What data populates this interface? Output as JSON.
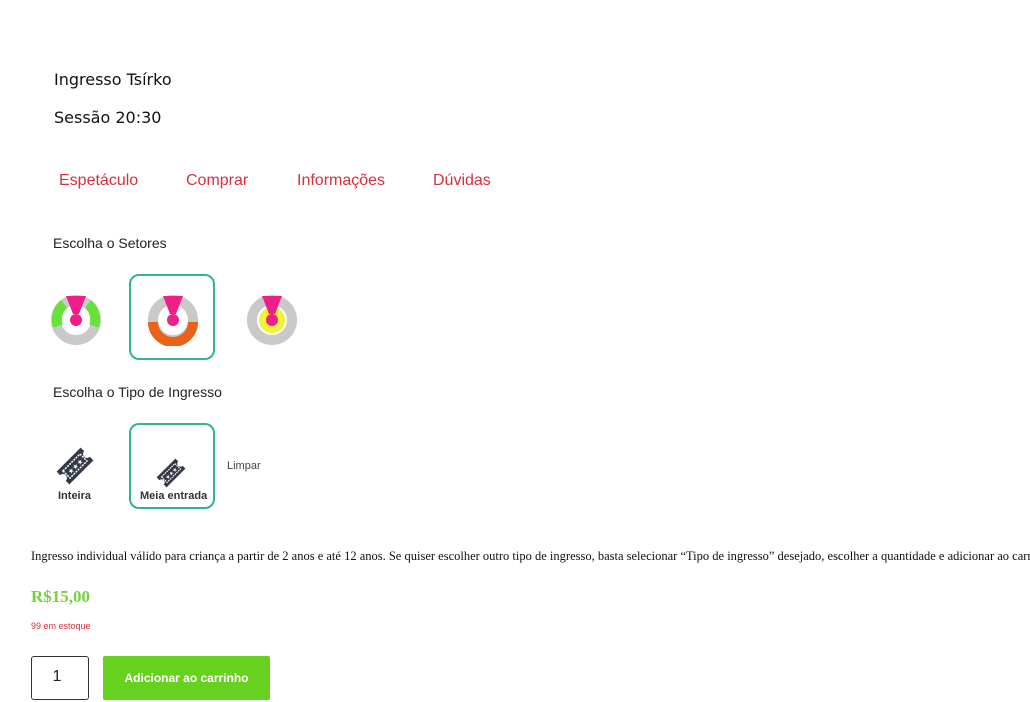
{
  "product": {
    "title": "Ingresso Tsírko",
    "session": "Sessão 20:30"
  },
  "tabs": [
    {
      "label": "Espetáculo"
    },
    {
      "label": "Comprar"
    },
    {
      "label": "Informações"
    },
    {
      "label": "Dúvidas"
    }
  ],
  "sectors": {
    "heading": "Escolha o Setores",
    "options": [
      {
        "icon": "stage-sector-green-icon",
        "accent": "#66e23a",
        "selected": false
      },
      {
        "icon": "stage-sector-orange-icon",
        "accent": "#e8621a",
        "selected": true
      },
      {
        "icon": "stage-sector-yellow-icon",
        "accent": "#f2f23a",
        "selected": false
      }
    ]
  },
  "ticket_type": {
    "heading": "Escolha o Tipo de Ingresso",
    "options": [
      {
        "label": "Inteira",
        "icon": "ticket-icon",
        "selected": false
      },
      {
        "label": "Meia entrada",
        "icon": "ticket-icon",
        "selected": true
      }
    ],
    "clear_label": "Limpar"
  },
  "description": "Ingresso individual válido para criança a partir de 2 anos e até 12 anos. Se quiser escolher outro tipo de ingresso, basta selecionar “Tipo de ingresso” desejado, escolher a quantidade e adicionar ao carrinho.",
  "price": "R$15,00",
  "stock": "99 em estoque",
  "cart": {
    "quantity": "1",
    "add_label": "Adicionar ao carrinho"
  },
  "colors": {
    "accent_red": "#d6303f",
    "select_border": "#2eb88a",
    "price_green": "#72d33d",
    "button_green": "#67d11f",
    "stage_pink": "#ef1f8a"
  }
}
